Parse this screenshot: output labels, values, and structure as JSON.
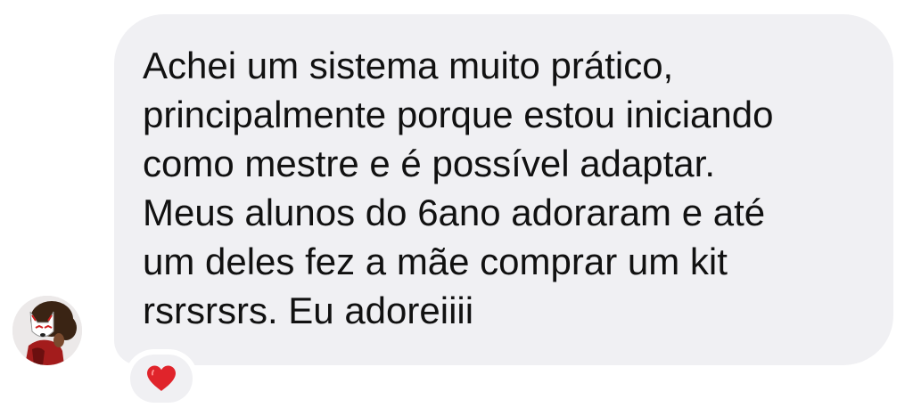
{
  "message": {
    "text": "Achei um sistema muito prático,\nprincipalmente porque  estou iniciando\ncomo mestre e é possível adaptar.\nMeus alunos do 6ano adoraram e até\num deles fez a mãe comprar um kit\nrsrsrsrs. Eu adoreiiii"
  },
  "reaction": {
    "icon": "heart-icon",
    "color": "#e0242b"
  },
  "avatar": {
    "icon": "user-avatar"
  },
  "colors": {
    "bubble": "#f0f0f3",
    "text": "#111111",
    "background": "#ffffff"
  }
}
